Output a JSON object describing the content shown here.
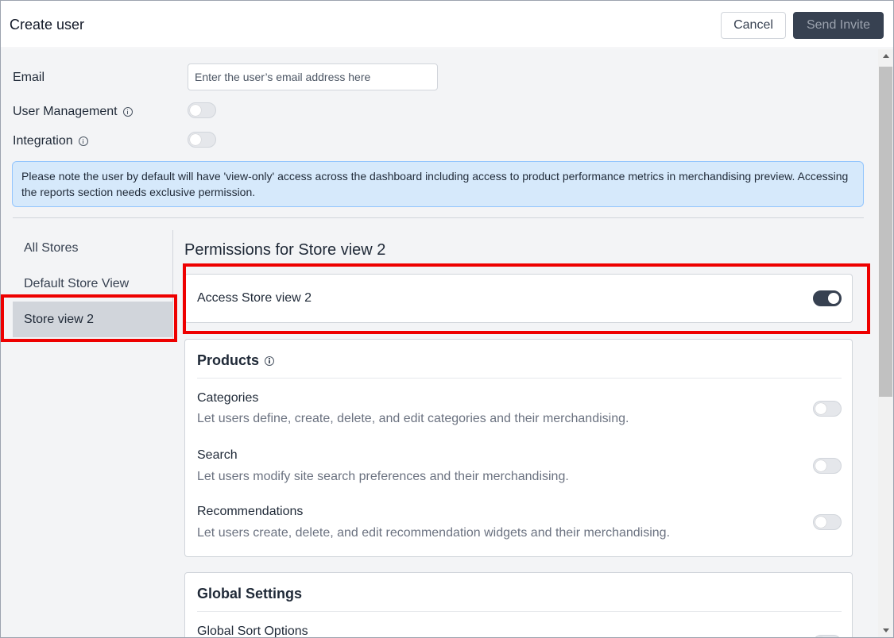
{
  "header": {
    "title": "Create user",
    "cancel_label": "Cancel",
    "send_label": "Send Invite"
  },
  "form": {
    "email_label": "Email",
    "email_placeholder": "Enter the user’s email address here",
    "email_value": "",
    "user_management_label": "User Management",
    "user_management_enabled": false,
    "integration_label": "Integration",
    "integration_enabled": false
  },
  "notice": {
    "text": "Please note the user by default will have 'view-only' access across the dashboard including access to product performance metrics in merchandising preview. Accessing the reports section needs exclusive permission."
  },
  "stores": {
    "items": [
      {
        "label": "All Stores",
        "active": false
      },
      {
        "label": "Default Store View",
        "active": false
      },
      {
        "label": "Store view 2",
        "active": true
      }
    ]
  },
  "permissions": {
    "title": "Permissions for Store view 2",
    "access_label": "Access Store view 2",
    "access_enabled": true,
    "products": {
      "title": "Products",
      "items": [
        {
          "name": "Categories",
          "description": "Let users define, create, delete, and edit categories and their merchandising.",
          "enabled": false
        },
        {
          "name": "Search",
          "description": "Let users modify site search preferences and their merchandising.",
          "enabled": false
        },
        {
          "name": "Recommendations",
          "description": "Let users create, delete, and edit recommendation widgets and their merchandising.",
          "enabled": false
        }
      ]
    },
    "global_settings": {
      "title": "Global Settings",
      "items": [
        {
          "name": "Global Sort Options",
          "enabled": false
        }
      ]
    }
  },
  "colors": {
    "primary_dark": "#374151",
    "notice_bg": "#d6e9fb",
    "highlight": "#ee0000"
  }
}
